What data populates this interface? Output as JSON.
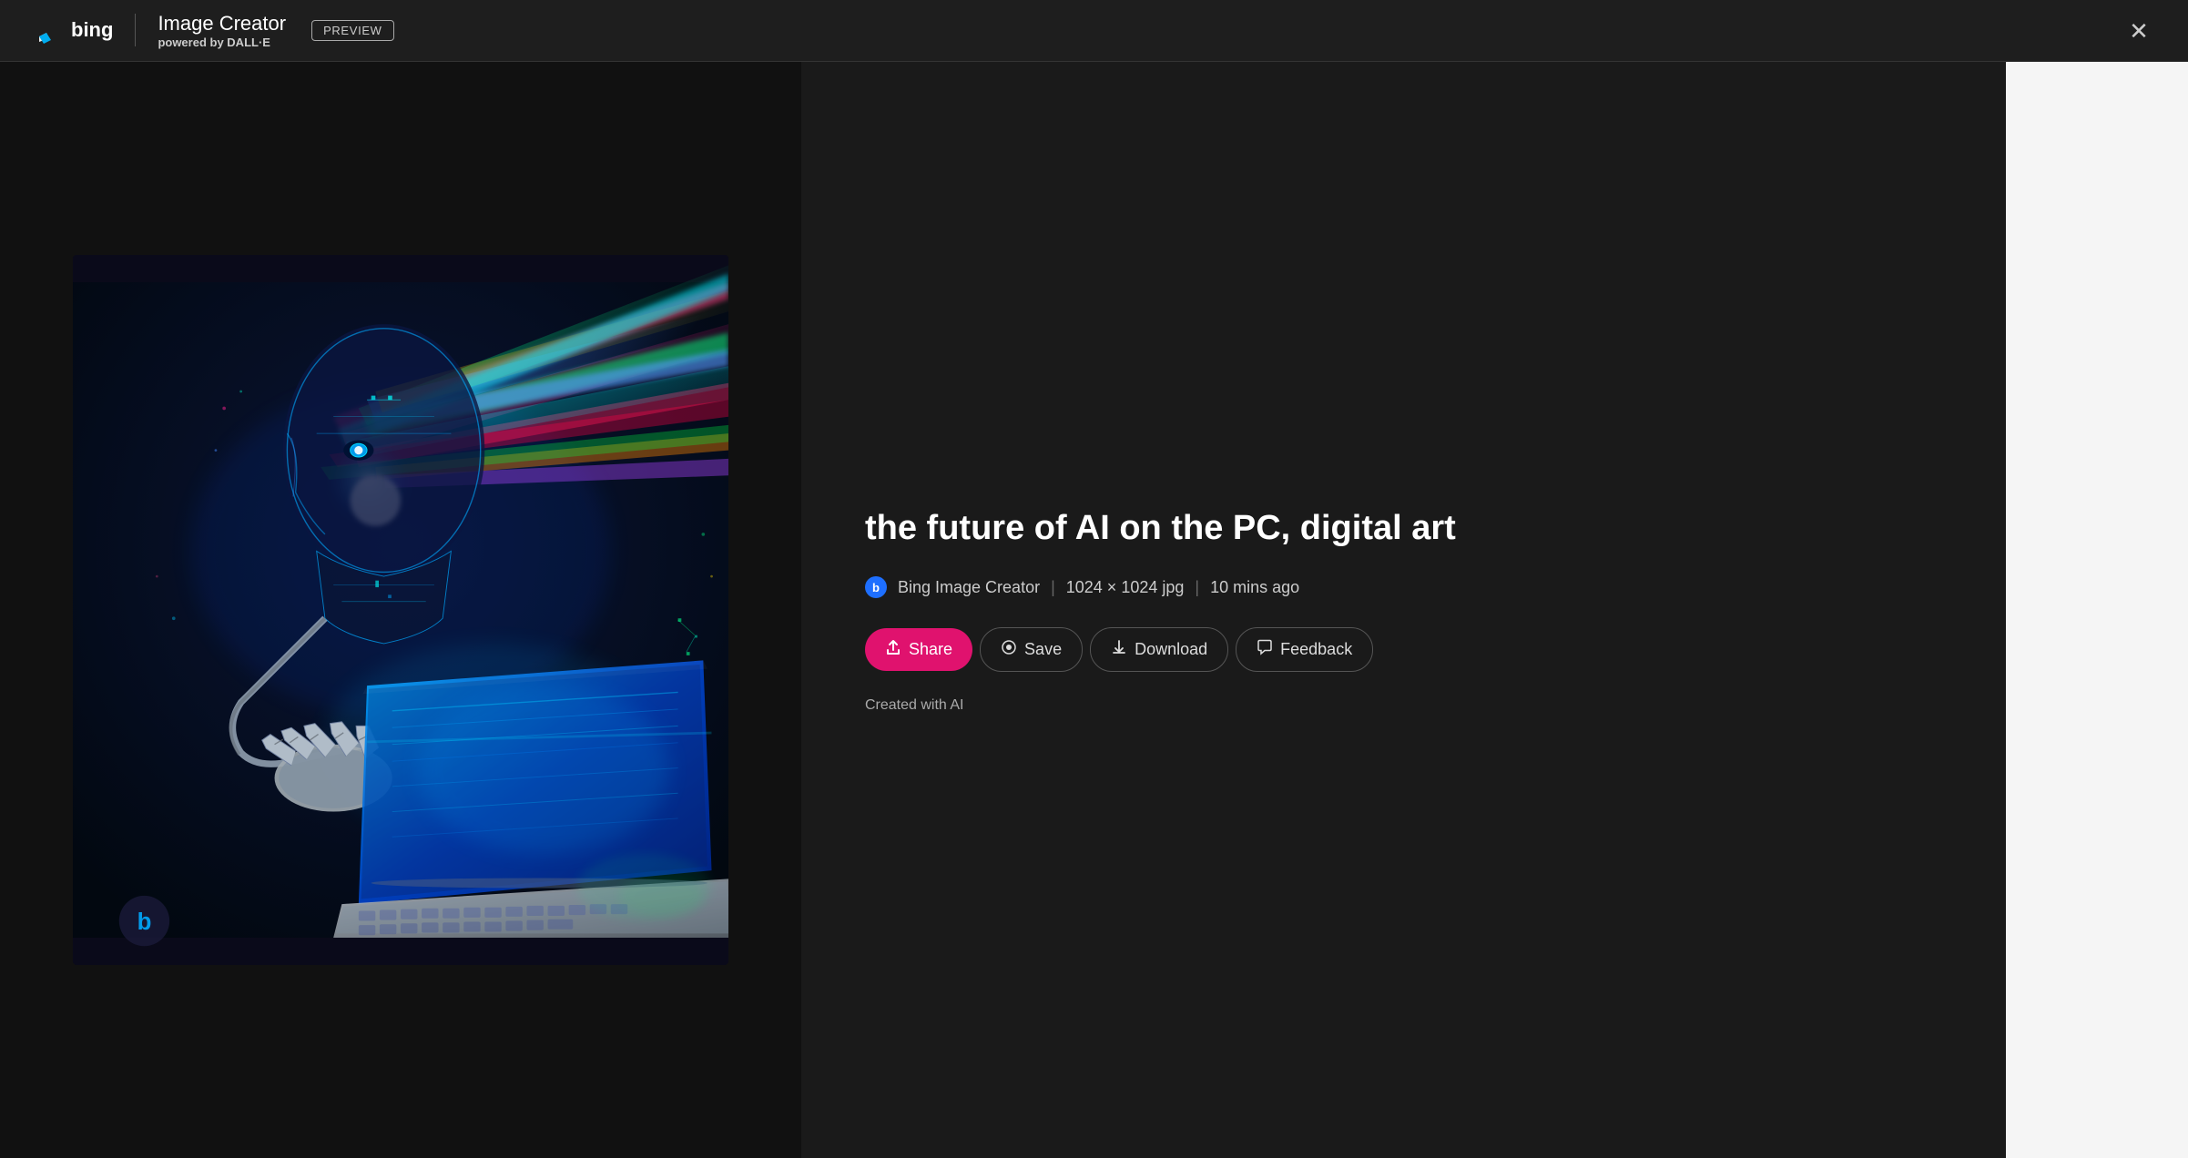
{
  "header": {
    "bing_logo_text": "bing",
    "title": "Image Creator",
    "subtitle_prefix": "powered by ",
    "subtitle_brand": "DALL·E",
    "preview_label": "PREVIEW",
    "close_label": "×"
  },
  "image": {
    "title": "the future of AI on the PC, digital art",
    "source": "Bing Image Creator",
    "dimensions": "1024 × 1024 jpg",
    "time_ago": "10 mins ago",
    "source_icon": "b"
  },
  "actions": {
    "share_label": "Share",
    "save_label": "Save",
    "download_label": "Download",
    "feedback_label": "Feedback",
    "created_with_ai": "Created with AI"
  },
  "icons": {
    "share": "↑",
    "save": "◎",
    "download": "↓",
    "feedback": "💬",
    "close": "✕"
  }
}
